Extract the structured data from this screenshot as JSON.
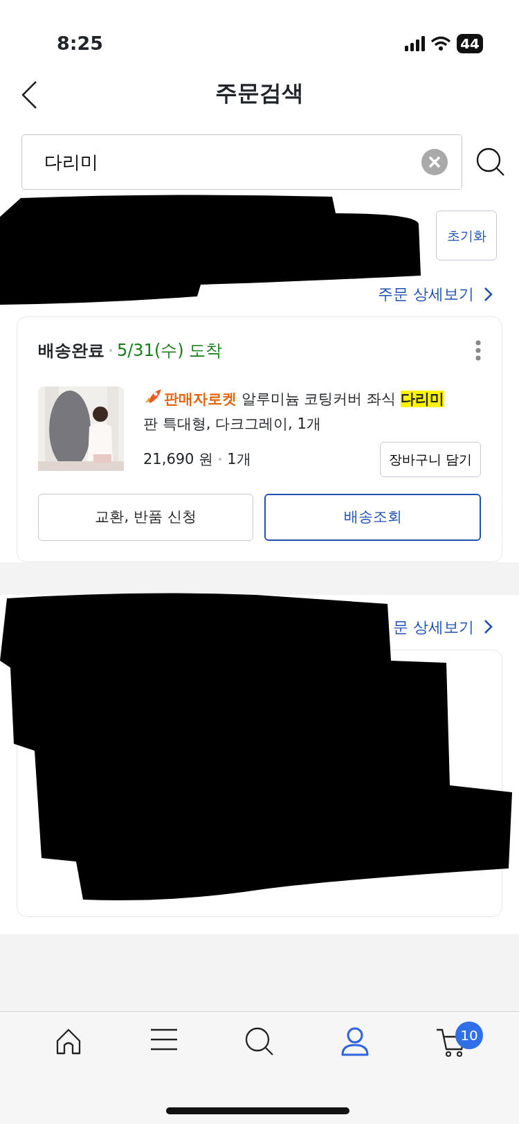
{
  "status_bar": {
    "time": "8:25",
    "battery": "44"
  },
  "header": {
    "title": "주문검색"
  },
  "search": {
    "value": "다리미"
  },
  "filter_row": {
    "redacted": true,
    "reset_button": "초기화"
  },
  "orders": [
    {
      "redacted": false,
      "detail_link": "주문 상세보기",
      "status": "배송완료",
      "arrival": "5/31(수) 도착",
      "badge": "판매자로켓",
      "name_before": "알루미늄 코팅커버 좌식",
      "highlight": "다리미",
      "name_after": "판 특대형, 다크그레이, 1개",
      "price": "21,690 원",
      "quantity": "1개",
      "cart_button": "장바구니 담기",
      "buttons": [
        {
          "label": "교환, 반품 신청",
          "kind": "outline"
        },
        {
          "label": "배송조회",
          "kind": "primary"
        }
      ]
    },
    {
      "redacted": true,
      "detail_link": "문 상세보기"
    }
  ],
  "bottom_nav": [
    {
      "kind": "home",
      "selected": false
    },
    {
      "kind": "menu",
      "selected": false
    },
    {
      "kind": "search",
      "selected": false
    },
    {
      "kind": "profile",
      "selected": true
    },
    {
      "kind": "cart",
      "selected": false,
      "badge": "10"
    }
  ]
}
